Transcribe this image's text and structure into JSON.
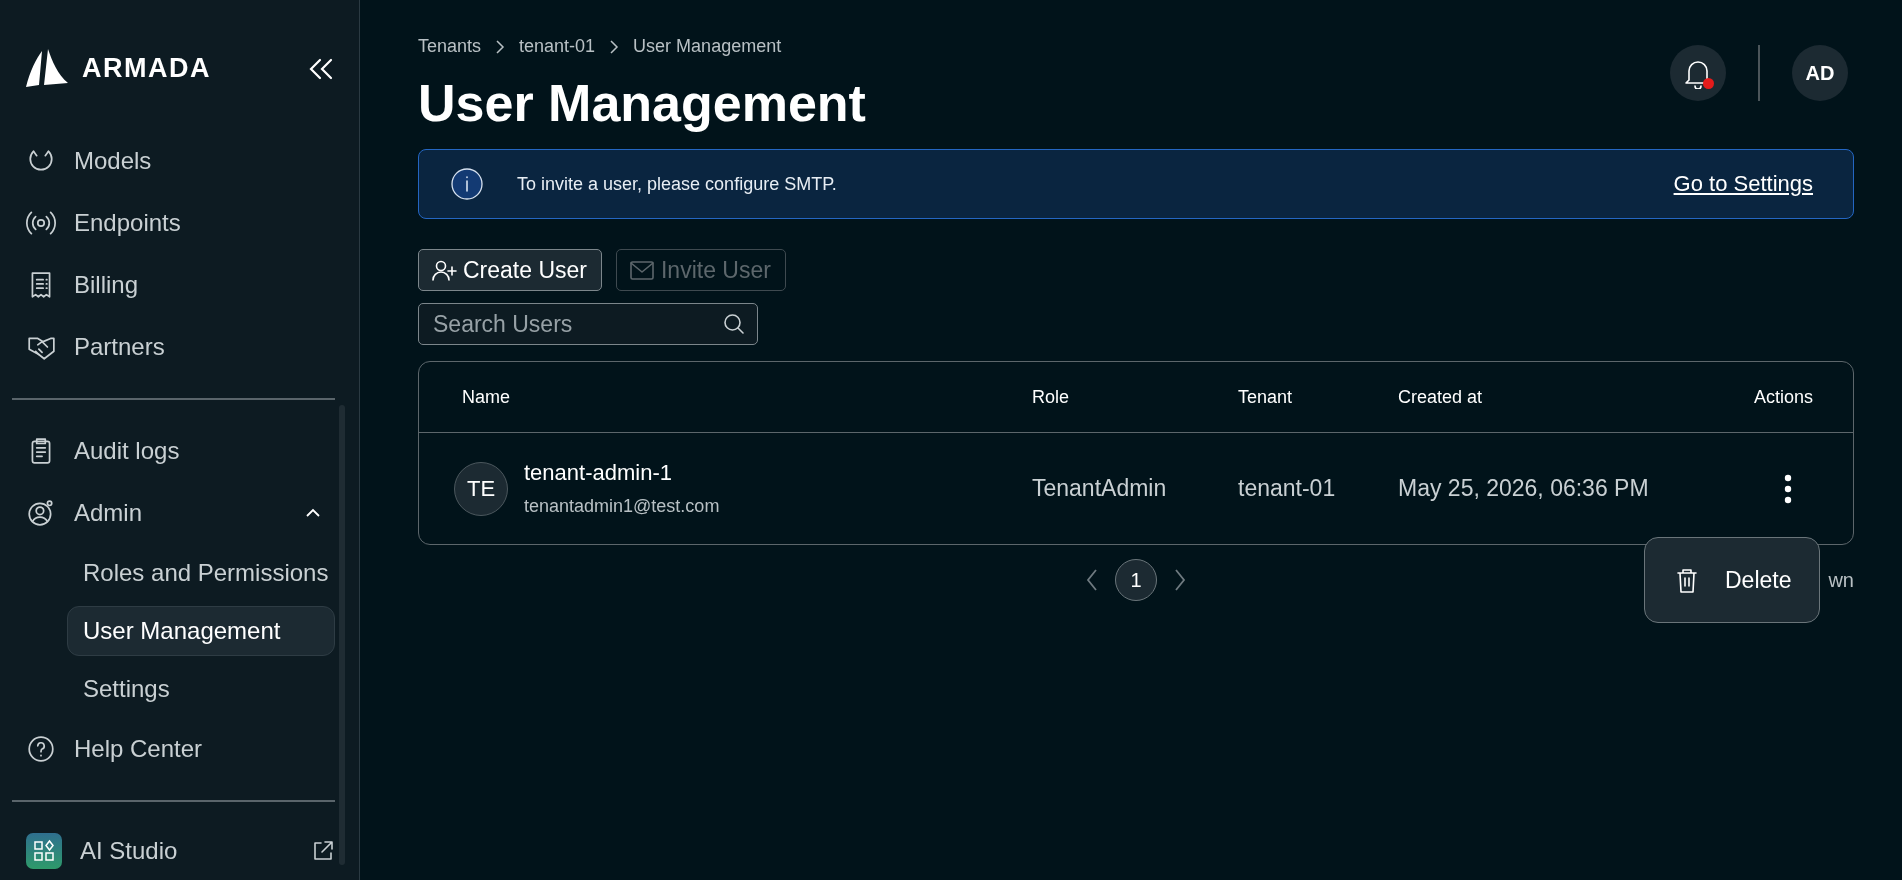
{
  "sidebar": {
    "logo": "ARMADA",
    "nav": [
      {
        "label": "Models",
        "kind": "models",
        "selected": false
      },
      {
        "label": "Endpoints",
        "kind": "endpoints",
        "selected": false
      },
      {
        "label": "Billing",
        "kind": "billing",
        "selected": false
      },
      {
        "label": "Partners",
        "kind": "partners",
        "selected": false
      }
    ],
    "secondary": [
      {
        "label": "Audit logs",
        "kind": "audit",
        "selected": false
      },
      {
        "label": "Admin",
        "kind": "admin",
        "selected": false,
        "expanded": true,
        "children": [
          {
            "label": "Roles and Permissions",
            "selected": false
          },
          {
            "label": "User Management",
            "selected": true
          },
          {
            "label": "Settings",
            "selected": false
          }
        ]
      },
      {
        "label": "Help Center",
        "kind": "help",
        "selected": false
      }
    ],
    "footer": {
      "label": "AI Studio"
    }
  },
  "header": {
    "breadcrumb": [
      "Tenants",
      "tenant-01",
      "User Management"
    ],
    "title": "User Management",
    "notifications_unread": true,
    "avatar": "AD"
  },
  "banner": {
    "message": "To invite a user, please configure SMTP.",
    "link": "Go to Settings"
  },
  "toolbar": {
    "buttons": [
      {
        "label": "Create User",
        "kind": "create",
        "disabled": false
      },
      {
        "label": "Invite User",
        "kind": "invite",
        "disabled": true
      }
    ],
    "search": {
      "placeholder": "Search Users"
    }
  },
  "table": {
    "columns": [
      "Name",
      "Role",
      "Tenant",
      "Created at",
      "Actions"
    ],
    "rows": [
      {
        "initials": "TE",
        "name": "tenant-admin-1",
        "email": "tenantadmin1@test.com",
        "role": "TenantAdmin",
        "tenant": "tenant-01",
        "created_at": "May 25, 2026, 06:36 PM"
      }
    ]
  },
  "pagination": {
    "pages": [
      {
        "label": "1",
        "selected": true
      }
    ],
    "info": "wn"
  },
  "context_menu": {
    "items": [
      {
        "label": "Delete",
        "kind": "delete"
      }
    ]
  }
}
